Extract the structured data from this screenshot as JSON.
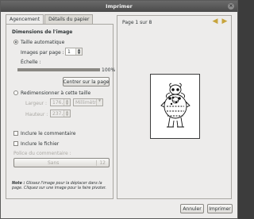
{
  "window": {
    "title": "Imprimer"
  },
  "tabs": [
    "Agencement",
    "Détails du papier"
  ],
  "dimensions": {
    "title": "Dimensions de l'image",
    "auto_size_label": "Taille automatique",
    "images_per_page_label": "Images par page :",
    "images_per_page_value": "1",
    "scale_label": "Échelle :",
    "scale_value": "100%",
    "scale_fraction": 1.0,
    "center_button": "Centrer sur la page",
    "resize_label": "Redimensionner à cette taille",
    "width_label": "Largeur :",
    "width_value": "176,8",
    "height_label": "Hauteur :",
    "height_value": "237,8",
    "unit_value": "Millimètres"
  },
  "options": {
    "comment_label": "Inclure le commentaire",
    "filename_label": "Inclure le fichier",
    "comment_font_label": "Police du commentaire :",
    "font_name": "Sans",
    "font_size": "12"
  },
  "note": {
    "label": "Note :",
    "text": "Glissez l'image pour la déplacer dans la page. Cliquez sur une image pour la faire pivoter."
  },
  "preview": {
    "page_label": "Page 1 sur 8",
    "prev_icon": "arrow-left-icon",
    "next_icon": "arrow-right-icon"
  },
  "buttons": {
    "cancel": "Annuler",
    "print": "Imprimer"
  }
}
